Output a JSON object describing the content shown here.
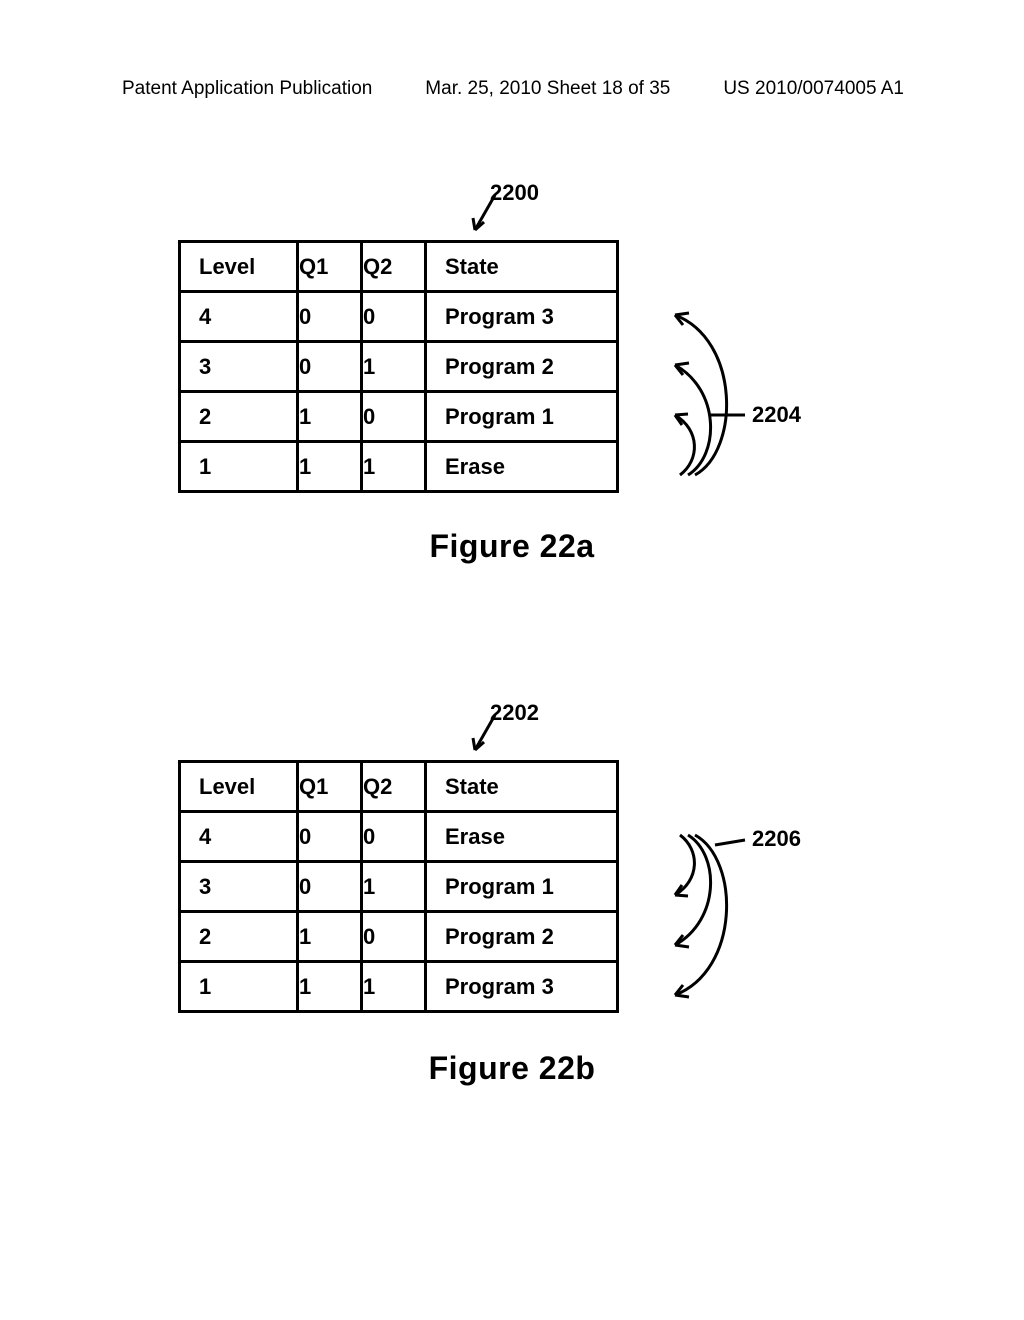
{
  "header": {
    "left": "Patent Application Publication",
    "mid": "Mar. 25, 2010  Sheet 18 of 35",
    "right": "US 2010/0074005 A1"
  },
  "figure_a": {
    "ref": "2200",
    "side_ref": "2204",
    "title": "Figure 22a",
    "headers": {
      "level": "Level",
      "q1": "Q1",
      "q2": "Q2",
      "state": "State"
    },
    "rows": [
      {
        "level": "4",
        "q1": "0",
        "q2": "0",
        "state": "Program 3"
      },
      {
        "level": "3",
        "q1": "0",
        "q2": "1",
        "state": "Program 2"
      },
      {
        "level": "2",
        "q1": "1",
        "q2": "0",
        "state": "Program 1"
      },
      {
        "level": "1",
        "q1": "1",
        "q2": "1",
        "state": "Erase"
      }
    ]
  },
  "figure_b": {
    "ref": "2202",
    "side_ref": "2206",
    "title": "Figure 22b",
    "headers": {
      "level": "Level",
      "q1": "Q1",
      "q2": "Q2",
      "state": "State"
    },
    "rows": [
      {
        "level": "4",
        "q1": "0",
        "q2": "0",
        "state": "Erase"
      },
      {
        "level": "3",
        "q1": "0",
        "q2": "1",
        "state": "Program 1"
      },
      {
        "level": "2",
        "q1": "1",
        "q2": "0",
        "state": "Program 2"
      },
      {
        "level": "1",
        "q1": "1",
        "q2": "1",
        "state": "Program 3"
      }
    ]
  }
}
